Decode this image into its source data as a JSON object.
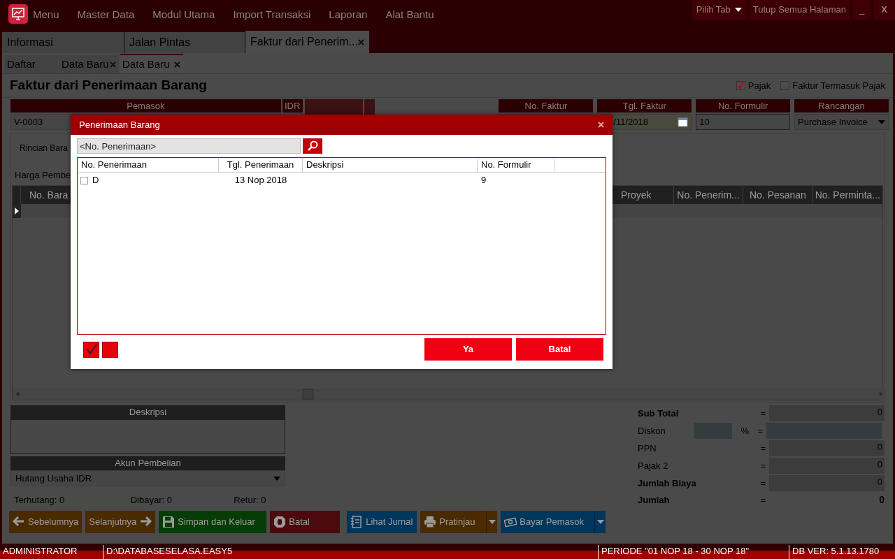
{
  "menu_bar": {
    "items": [
      "Menu",
      "Master Data",
      "Modul Utama",
      "Import Transaksi",
      "Laporan",
      "Alat Bantu"
    ],
    "pick_tab": "Pilih Tab",
    "close_all": "Tutup Semua Halaman",
    "minimize": "_",
    "close": "X"
  },
  "page_tabs": [
    {
      "label": "Informasi",
      "selected": false,
      "closable": false
    },
    {
      "label": "Jalan Pintas",
      "selected": false,
      "closable": false
    },
    {
      "label": "Faktur dari Penerim...",
      "selected": true,
      "closable": true
    }
  ],
  "sub_tabs": [
    {
      "label": "Daftar",
      "selected": false,
      "closable": false
    },
    {
      "label": "Data Baru",
      "selected": false,
      "closable": true
    },
    {
      "label": "Data Baru",
      "selected": true,
      "closable": true
    }
  ],
  "form": {
    "title": "Faktur dari Penerimaan Barang",
    "options": [
      {
        "label": "Pajak",
        "checked": true
      },
      {
        "label": "Faktur Termasuk Pajak",
        "checked": false
      }
    ],
    "supplier": {
      "label": "Pemasok",
      "value": "V-0003"
    },
    "currency": "IDR",
    "fields": [
      {
        "label": "No. Faktur",
        "kind": "text"
      },
      {
        "label": "Tgl. Faktur",
        "value": "/11/2018",
        "kind": "date"
      },
      {
        "label": "No. Formulir",
        "value": "10",
        "kind": "text"
      },
      {
        "label": "Rancangan",
        "value": "Purchase Invoice",
        "kind": "select"
      }
    ],
    "detail_tab": "Rincian Bara",
    "price_label": "Harga Pembe",
    "grid_columns": [
      "No. Bara",
      "Proyek",
      "No. Penerim...",
      "No. Pesanan",
      "No. Perminta..."
    ],
    "description_label": "Deskripsi",
    "account": {
      "label": "Akun Pembelian",
      "value": "Hutang Usaha IDR"
    },
    "summary": [
      "Terhutang: 0",
      "Dibayar: 0",
      "Retur: 0"
    ],
    "totals": [
      {
        "label": "Sub Total",
        "bold": true,
        "sign": "=",
        "value": "0",
        "kind": "field"
      },
      {
        "label": "Diskon",
        "bold": false,
        "percent": "%",
        "sign": "=",
        "kind": "discount"
      },
      {
        "label": "PPN",
        "bold": false,
        "sign": "=",
        "value": "0",
        "kind": "field"
      },
      {
        "label": "Pajak 2",
        "bold": false,
        "sign": "=",
        "value": "0",
        "kind": "field"
      },
      {
        "label": "Jumlah Biaya",
        "bold": true,
        "sign": "=",
        "value": "0",
        "kind": "field"
      },
      {
        "label": "Jumlah",
        "bold": true,
        "sign": "=",
        "value": "0",
        "kind": "plain"
      }
    ],
    "actions": [
      {
        "label": "Sebelumnya",
        "color": "#4a2a00",
        "dropdown": false
      },
      {
        "label": "Selanjutnya",
        "color": "#4a2a00",
        "dropdown": false
      },
      {
        "label": "Simpan dan Keluar",
        "color": "#063c06",
        "dropdown": false
      },
      {
        "label": "Batal",
        "color": "#4c0a0e",
        "dropdown": false
      },
      {
        "label": "Lihat Jurnal",
        "color": "#00355c",
        "dropdown": false
      },
      {
        "label": "Pratinjau",
        "color": "#4a2a00",
        "dropdown": true
      },
      {
        "label": "Bayar Pemasok",
        "color": "#00355c",
        "dropdown": true
      }
    ]
  },
  "status_bar": [
    "ADMINISTRATOR",
    "D:\\DATABASESELASA.EASY5",
    "PERIODE \"01 NOP 18 - 30 NOP 18\"",
    "DB VER: 5.1.13.1780"
  ],
  "dialog": {
    "title": "Penerimaan Barang",
    "search": {
      "placeholder": "<No. Penerimaan>"
    },
    "columns": [
      "No. Penerimaan",
      "Tgl. Penerimaan",
      "Deskripsi",
      "No. Formulir"
    ],
    "rows": [
      {
        "checked": false,
        "number": "D",
        "date": "13 Nop 2018",
        "form_no": "9"
      }
    ],
    "buttons": [
      "Ya",
      "Batal"
    ]
  }
}
